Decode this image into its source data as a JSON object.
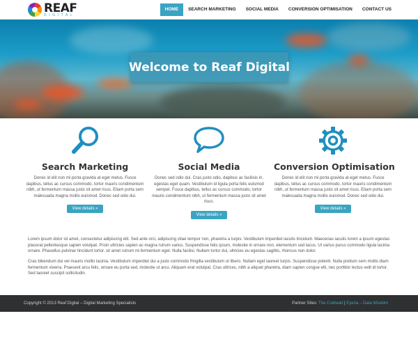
{
  "logo": {
    "name": "REAF",
    "sub": "DIGITAL"
  },
  "nav": {
    "items": [
      {
        "label": "HOME"
      },
      {
        "label": "SEARCH MARKETING"
      },
      {
        "label": "SOCIAL MEDIA"
      },
      {
        "label": "CONVERSION OPTIMISATION"
      },
      {
        "label": "CONTACT US"
      }
    ],
    "active": "HOME"
  },
  "hero": {
    "title": "Welcome to Reaf Digital"
  },
  "features": [
    {
      "icon": "magnifier-icon",
      "title": "Search Marketing",
      "text": "Donec id elit non mi porta gravida at eget metus. Fusce dapibus, tellus ac cursus commodo, tortor mauris condimentum nibh, ut fermentum massa justo sit amet risus. Etiam porta sem malesuada magna mollis euismod. Donec sed odio dui.",
      "button": "View details »"
    },
    {
      "icon": "speech-bubble-icon",
      "title": "Social Media",
      "text": "Donec sed odio dui. Cras justo odio, dapibus ac facilisis in, egestas eget quam. Vestibulum id ligula porta felis euismod semper. Fusce dapibus, tellus ac cursus commodo, tortor mauris condimentum nibh, ut fermentum massa justo sit amet risus.",
      "button": "View details »"
    },
    {
      "icon": "gear-icon",
      "title": "Conversion Optimisation",
      "text": "Donec id elit non mi porta gravida at eget metus. Fusce dapibus, tellus ac cursus commodo, tortor mauris condimentum nibh, ut fermentum massa justo sit amet risus. Etiam porta sem malesuada magna mollis euismod. Donec sed odio dui.",
      "button": "View details »"
    }
  ],
  "body": {
    "p1": "Lorem ipsum dolor sit amet, consectetur adipiscing elit. Sed ante orci, adipiscing vitae tempor non, pharetra a turpis. Vestibulum imperdiet iaculis tincidunt. Maecenas iaculis lorem a ipsum egestas placerat pellentesque sapien volutpat. Proin ultricies sapien ac magna rutrum varius. Suspendisse felis ipsum, molestie in ornare non, elementum sed lacus. Ut varius purus commodo ligula lacinia ornare. Phasellus pulvinar tincidunt tortor, sit amet rutrum mi fermentum eget. Nulla facilisi. Nullam tortor dui, ultricies eu egestas sagittis, rhoncus non dolor.",
    "p2": "Cras bibendum dui vel mauris mollis lacinia. Vestibulum imperdiet dui a justo commodo fringilla vestibulum ut libero. Nullam eget laoreet turpis. Suspendisse potenti. Nulla pretium sem mollis diam fermentum viverra. Praesent arcu felis, ornare eu porta sed, molestie ut arcu. Aliquam erat volutpat. Cras ultrices, nibh a aliquet pharetra, diam sapien congue elit, nec porttitor lectus velit id tortor. Sed laoreet suscipit sollicitudin."
  },
  "footer": {
    "copyright": "Copyright © 2013 Reaf Digital – Digital Marketing Specialists",
    "partners_label": "Partner Sites:",
    "partner1": "The Coldwatt",
    "separator": "|",
    "partner2": "Eyeria",
    "dash": "–",
    "partner3": "Data Wisdom"
  },
  "colors": {
    "accent": "#3aa4c2",
    "footer_bg": "#2f3032"
  }
}
